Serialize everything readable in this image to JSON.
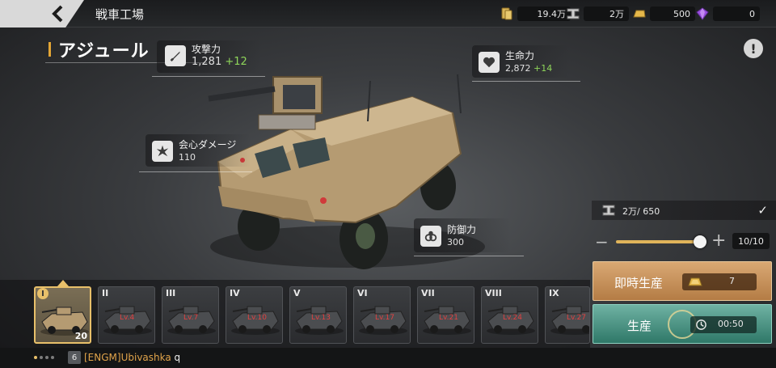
{
  "header": {
    "title": "戦車工場",
    "resources": [
      {
        "icon": "gold-bars-icon",
        "value": "19.4万"
      },
      {
        "icon": "steel-beam-icon",
        "value": "2万"
      },
      {
        "icon": "gold-ingot-icon",
        "value": "500"
      },
      {
        "icon": "gem-icon",
        "value": "0"
      }
    ]
  },
  "vehicle": {
    "name": "アジュール",
    "info_label": "!"
  },
  "stats": {
    "attack": {
      "label": "攻撃力",
      "value": "1,281",
      "bonus": "+12"
    },
    "hp": {
      "label": "生命力",
      "value": "2,872",
      "bonus": "+14"
    },
    "crit": {
      "label": "会心ダメージ",
      "value": "110"
    },
    "defense": {
      "label": "防御力",
      "value": "300"
    }
  },
  "production": {
    "cost": "2万/ 650",
    "quantity": "10/10",
    "quantity_fraction": 1.0,
    "instant_label": "即時生産",
    "instant_cost": "7",
    "produce_label": "生産",
    "produce_time": "00:50"
  },
  "tanks": [
    {
      "tier": "I",
      "level": "",
      "count": "20",
      "selected": true
    },
    {
      "tier": "II",
      "level": "Lv.4"
    },
    {
      "tier": "III",
      "level": "Lv.7"
    },
    {
      "tier": "IV",
      "level": "Lv.10"
    },
    {
      "tier": "V",
      "level": "Lv.13"
    },
    {
      "tier": "VI",
      "level": "Lv.17"
    },
    {
      "tier": "VII",
      "level": "Lv.21"
    },
    {
      "tier": "VIII",
      "level": "Lv.24"
    },
    {
      "tier": "IX",
      "level": "Lv.27"
    }
  ],
  "chat": {
    "channel": "6",
    "guild": "[ENGM]",
    "user": "Ubivashka",
    "message": "q"
  },
  "colors": {
    "accent": "#e8c06a",
    "bonus_green": "#8fd65a",
    "lock_red": "#e04141",
    "instant_button": "#c89259",
    "produce_button": "#4f9585"
  }
}
